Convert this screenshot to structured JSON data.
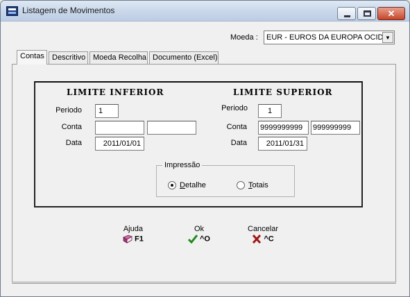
{
  "window": {
    "title": "Listagem de Movimentos"
  },
  "moeda": {
    "label": "Moeda :",
    "value": "EUR - EUROS DA EUROPA OCID"
  },
  "tabs": [
    {
      "label": "Contas"
    },
    {
      "label": "Descritivo"
    },
    {
      "label": "Moeda Recolha"
    },
    {
      "label": "Documento (Excel)"
    }
  ],
  "inferior": {
    "heading": "LIMITE INFERIOR",
    "periodo_label": "Periodo",
    "periodo": "1",
    "conta_label": "Conta",
    "conta_1": "",
    "conta_2": "",
    "data_label": "Data",
    "data": "2011/01/01"
  },
  "superior": {
    "heading": "LIMITE SUPERIOR",
    "periodo_label": "Periodo",
    "periodo": "1",
    "conta_label": "Conta",
    "conta_1": "9999999999",
    "conta_2": "999999999",
    "data_label": "Data",
    "data": "2011/01/31"
  },
  "impressao": {
    "legend": "Impressão",
    "detalhe_first": "D",
    "detalhe_rest": "etalhe",
    "totais_first": "T",
    "totais_rest": "otais",
    "selected": "Detalhe"
  },
  "actions": {
    "ajuda": {
      "label": "Ajuda",
      "key": "F1"
    },
    "ok": {
      "label": "Ok",
      "key": "^O"
    },
    "cancelar": {
      "label": "Cancelar",
      "key": "^C"
    }
  },
  "icons": {
    "app": "app-list-icon",
    "help": "book-icon",
    "ok": "checkmark-icon",
    "cancel": "x-icon"
  },
  "colors": {
    "checkmark": "#1e8a1e",
    "cancel": "#a01818",
    "book": "#b04080"
  }
}
